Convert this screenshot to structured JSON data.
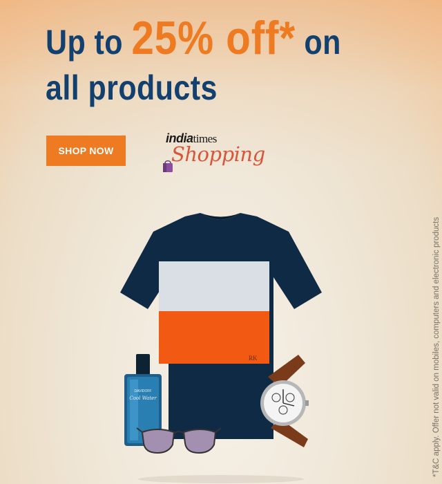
{
  "banner": {
    "headline_pre": "Up to ",
    "headline_accent": "25% off*",
    "headline_post": " on all products",
    "cta_label": "SHOP NOW",
    "logo_india": "india",
    "logo_times": "times",
    "logo_shopping": "Shopping",
    "disclaimer": "*T&C apply. Offer not valid on mobiles, computers and electronic products"
  },
  "products": {
    "tshirt_label": "RK",
    "perfume_brand": "DAVIDOFF",
    "perfume_name": "Cool Water"
  },
  "colors": {
    "headline": "#12406f",
    "accent": "#ee7b22",
    "tshirt_navy": "#0f2a44",
    "tshirt_stripe_white": "#d9dfe5",
    "tshirt_stripe_orange": "#f25a14"
  },
  "icons": [
    "shopping-bag-icon"
  ]
}
